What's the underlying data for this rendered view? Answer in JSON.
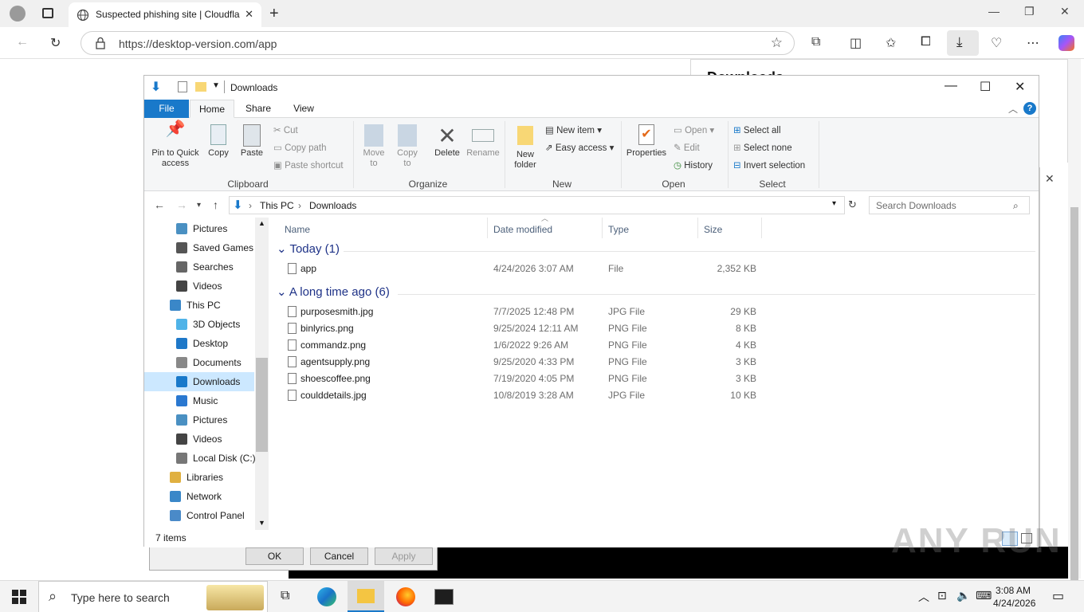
{
  "browser": {
    "tab_title": "Suspected phishing site | Cloudfla",
    "url": "https://desktop-version.com/app",
    "downloads_panel_title": "Downloads"
  },
  "explorer": {
    "title": "Downloads",
    "ribbon_tabs": [
      "File",
      "Home",
      "Share",
      "View"
    ],
    "clipboard": {
      "pin": "Pin to Quick access",
      "copy": "Copy",
      "paste": "Paste",
      "cut": "Cut",
      "copy_path": "Copy path",
      "paste_shortcut": "Paste shortcut",
      "label": "Clipboard"
    },
    "organize": {
      "move_to": "Move to",
      "copy_to": "Copy to",
      "delete": "Delete",
      "rename": "Rename",
      "label": "Organize"
    },
    "new": {
      "new_folder": "New folder",
      "new_item": "New item",
      "easy_access": "Easy access",
      "label": "New"
    },
    "open": {
      "properties": "Properties",
      "open": "Open",
      "edit": "Edit",
      "history": "History",
      "label": "Open"
    },
    "select": {
      "select_all": "Select all",
      "select_none": "Select none",
      "invert": "Invert selection",
      "label": "Select"
    },
    "breadcrumb": [
      "This PC",
      "Downloads"
    ],
    "search_placeholder": "Search Downloads",
    "nav_items": [
      {
        "label": "Pictures",
        "icon": "pictures-icon",
        "indent": 2
      },
      {
        "label": "Saved Games",
        "icon": "saved-games-icon",
        "indent": 2
      },
      {
        "label": "Searches",
        "icon": "search-icon",
        "indent": 2
      },
      {
        "label": "Videos",
        "icon": "videos-icon",
        "indent": 2
      },
      {
        "label": "This PC",
        "icon": "computer-icon",
        "indent": 1
      },
      {
        "label": "3D Objects",
        "icon": "3d-objects-icon",
        "indent": 2
      },
      {
        "label": "Desktop",
        "icon": "desktop-icon",
        "indent": 2
      },
      {
        "label": "Documents",
        "icon": "documents-icon",
        "indent": 2
      },
      {
        "label": "Downloads",
        "icon": "downloads-icon",
        "indent": 2,
        "selected": true
      },
      {
        "label": "Music",
        "icon": "music-icon",
        "indent": 2
      },
      {
        "label": "Pictures",
        "icon": "pictures-icon",
        "indent": 2
      },
      {
        "label": "Videos",
        "icon": "videos-icon",
        "indent": 2
      },
      {
        "label": "Local Disk (C:)",
        "icon": "drive-icon",
        "indent": 2
      },
      {
        "label": "Libraries",
        "icon": "libraries-icon",
        "indent": 1
      },
      {
        "label": "Network",
        "icon": "network-icon",
        "indent": 1
      },
      {
        "label": "Control Panel",
        "icon": "control-panel-icon",
        "indent": 1
      }
    ],
    "columns": {
      "name": "Name",
      "date": "Date modified",
      "type": "Type",
      "size": "Size"
    },
    "groups": [
      {
        "title": "Today (1)",
        "files": [
          {
            "name": "app",
            "date": "4/24/2026 3:07 AM",
            "type": "File",
            "size": "2,352 KB"
          }
        ]
      },
      {
        "title": "A long time ago (6)",
        "files": [
          {
            "name": "purposesmith.jpg",
            "date": "7/7/2025 12:48 PM",
            "type": "JPG File",
            "size": "29 KB"
          },
          {
            "name": "binlyrics.png",
            "date": "9/25/2024 12:11 AM",
            "type": "PNG File",
            "size": "8 KB"
          },
          {
            "name": "commandz.png",
            "date": "1/6/2022 9:26 AM",
            "type": "PNG File",
            "size": "4 KB"
          },
          {
            "name": "agentsupply.png",
            "date": "9/25/2020 4:33 PM",
            "type": "PNG File",
            "size": "3 KB"
          },
          {
            "name": "shoescoffee.png",
            "date": "7/19/2020 4:05 PM",
            "type": "PNG File",
            "size": "3 KB"
          },
          {
            "name": "coulddetails.jpg",
            "date": "10/8/2019 3:28 AM",
            "type": "JPG File",
            "size": "10 KB"
          }
        ]
      }
    ],
    "status": "7 items"
  },
  "dialog": {
    "ok": "OK",
    "cancel": "Cancel",
    "apply": "Apply"
  },
  "taskbar": {
    "search_placeholder": "Type here to search",
    "time": "3:08 AM",
    "date": "4/24/2026"
  },
  "watermark": "ANY RUN",
  "colors": {
    "file_tab": "#1979ca",
    "selection": "#cce8ff",
    "group_heading": "#1e3287"
  }
}
